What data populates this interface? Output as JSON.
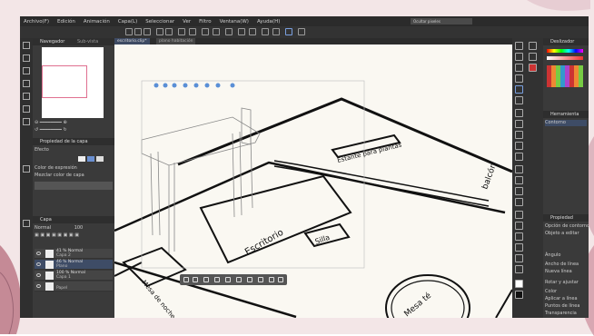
{
  "menu": [
    "Archivo(F)",
    "Edición",
    "Animación",
    "Capa(L)",
    "Seleccionar",
    "Ver",
    "Filtro",
    "Ventana(W)",
    "Ayuda(H)"
  ],
  "topbars": {
    "left": "Ocultar pixeles",
    "right": "Ocultar pixeles"
  },
  "tabs": [
    {
      "label": "escritorio.clip*"
    },
    {
      "label": "plano habitación"
    }
  ],
  "navigator": {
    "tab1": "Navegador",
    "tab2": "Sub-vista"
  },
  "layer_property": {
    "title": "Propiedad de la capa",
    "effect": "Efecto",
    "expression_color": "Color de expresión",
    "multi_layer": "Mezclar color de capa"
  },
  "layers_panel": {
    "title": "Capa",
    "blend": "Normal",
    "opacity": "100",
    "layers": [
      {
        "opacity": "41 % Normal",
        "name": "Capa 2"
      },
      {
        "opacity": "46 % Normal",
        "name": "Plano",
        "selected": true
      },
      {
        "opacity": "100 % Normal",
        "name": "Capa 1"
      },
      {
        "opacity": "",
        "name": "Papel"
      }
    ]
  },
  "drawing_labels": {
    "estante": "Estante para plantas",
    "escritorio": "Escritorio",
    "silla": "Silla",
    "mesa_noche": "Mesa de noche",
    "balcon": "balcón",
    "mesa_te": "Mesa té"
  },
  "right_panel": {
    "title1": "Deslizador",
    "title2": "Herramienta",
    "sub_title": "Contorno",
    "prop_title": "Propiedad",
    "items": [
      "Opción de contorno",
      "Objeto a editar",
      "Ángulo",
      "Ancho de línea",
      "Nueva línea",
      "Rotar y ajustar",
      "Color",
      "Aplicar a línea",
      "Puntos de línea",
      "Transparencia"
    ]
  },
  "colors": {
    "accent": "#3e4c66",
    "canvas": "#faf8f2",
    "nav_frame": "#e07090"
  }
}
